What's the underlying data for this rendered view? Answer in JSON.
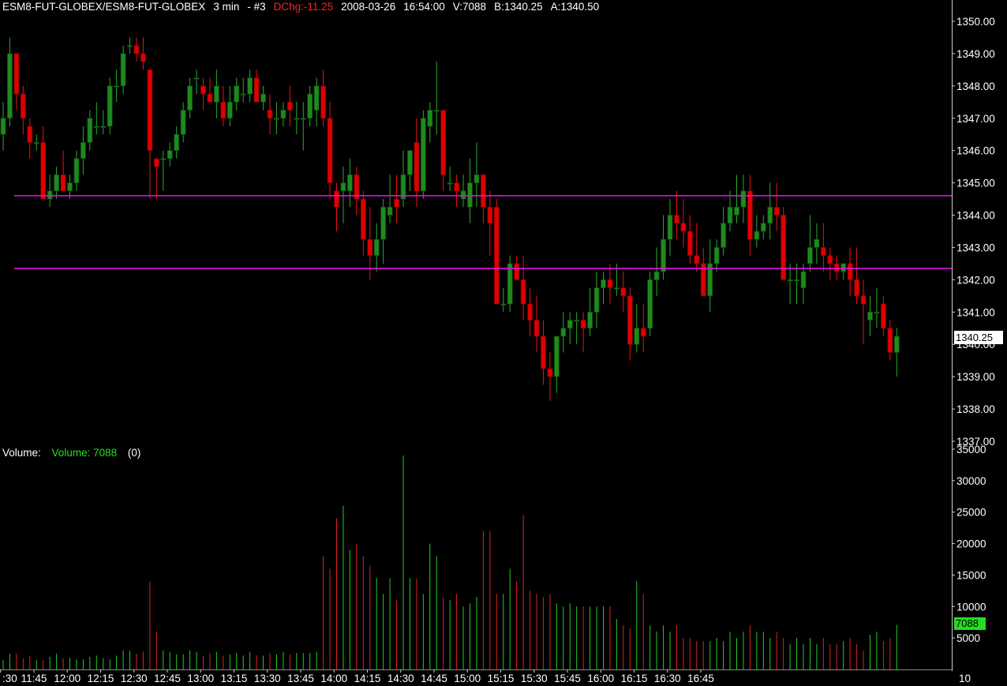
{
  "header": {
    "symbol": "ESM8-FUT-GLOBEX/ESM8-FUT-GLOBEX",
    "interval": "3 min",
    "tag": "- #3",
    "dchg": "DChg:-11.25",
    "date": "2008-03-26",
    "time": "16:54:00",
    "volume": "V:7088",
    "bid": "B:1340.25",
    "ask": "A:1340.50"
  },
  "volume_label": {
    "title": "Volume:",
    "value": "Volume: 7088",
    "param": "(0)"
  },
  "colors": {
    "up": "#1f8a1f",
    "down": "#e00000",
    "line": "#e010e0",
    "up_volume": "#22cc22",
    "down_volume": "#dd2222",
    "axis_text": "#ffffff",
    "last_volume_bg": "#22dd22"
  },
  "current_price_label": "1340.25",
  "current_volume_label": "7088",
  "chart_data": [
    {
      "type": "candlestick",
      "title": "ESM8-FUT-GLOBEX 3 min",
      "ylim": [
        1337,
        1350.25
      ],
      "yticks": [
        "1337.00",
        "1338.00",
        "1339.00",
        "1340.00",
        "1341.00",
        "1342.00",
        "1343.00",
        "1344.00",
        "1345.00",
        "1346.00",
        "1347.00",
        "1348.00",
        "1349.00",
        "1350.00"
      ],
      "xticks": [
        ":30",
        "11:45",
        "12:00",
        "12:15",
        "12:30",
        "12:45",
        "13:00",
        "13:15",
        "13:30",
        "13:45",
        "14:00",
        "14:15",
        "14:30",
        "14:45",
        "15:00",
        "15:15",
        "15:30",
        "15:45",
        "16:00",
        "16:15",
        "16:30",
        "16:45"
      ],
      "horizontal_lines": [
        1344.6,
        1342.35
      ],
      "candles": [
        [
          1346.5,
          1347.5,
          1346,
          1347
        ],
        [
          1347,
          1349.5,
          1346.75,
          1349
        ],
        [
          1349,
          1349,
          1347.25,
          1347.75
        ],
        [
          1347.75,
          1348,
          1346.5,
          1347
        ],
        [
          1346.75,
          1347,
          1345.75,
          1346.25
        ],
        [
          1346.25,
          1346.5,
          1346,
          1346.25
        ],
        [
          1346.25,
          1346.75,
          1344.5,
          1344.5
        ],
        [
          1344.5,
          1345.25,
          1344.25,
          1344.75
        ],
        [
          1344.75,
          1345.5,
          1344.5,
          1345.25
        ],
        [
          1345.25,
          1346,
          1344.75,
          1344.75
        ],
        [
          1344.75,
          1345.25,
          1344.5,
          1345
        ],
        [
          1345,
          1346,
          1344.75,
          1345.75
        ],
        [
          1345.75,
          1346.75,
          1345.25,
          1346.25
        ],
        [
          1346.25,
          1347.25,
          1346,
          1347
        ],
        [
          1346.75,
          1347.5,
          1346.5,
          1346.75
        ],
        [
          1346.75,
          1347.25,
          1346.5,
          1346.75
        ],
        [
          1346.75,
          1348.25,
          1346.5,
          1348
        ],
        [
          1348,
          1348.5,
          1347.5,
          1348
        ],
        [
          1348,
          1349.25,
          1347.75,
          1349
        ],
        [
          1349.25,
          1349.5,
          1349,
          1349.25
        ],
        [
          1349.25,
          1349.5,
          1348.75,
          1349
        ],
        [
          1349,
          1349.5,
          1348.5,
          1348.75
        ],
        [
          1348.5,
          1348.5,
          1344.5,
          1346
        ],
        [
          1345.75,
          1345.75,
          1344.5,
          1345.5
        ],
        [
          1345.75,
          1346,
          1344.75,
          1345.75
        ],
        [
          1345.75,
          1346.25,
          1345.5,
          1346
        ],
        [
          1346,
          1346.75,
          1345.75,
          1346.5
        ],
        [
          1346.5,
          1347.5,
          1346.25,
          1347.25
        ],
        [
          1347.25,
          1348.25,
          1347,
          1348
        ],
        [
          1348.25,
          1348.5,
          1347.75,
          1348.25
        ],
        [
          1348,
          1348.25,
          1347.25,
          1347.75
        ],
        [
          1347.75,
          1348.25,
          1347.5,
          1347.5
        ],
        [
          1347.5,
          1348.5,
          1347,
          1348
        ],
        [
          1347.5,
          1348,
          1346.75,
          1347
        ],
        [
          1347,
          1348,
          1346.75,
          1347.5
        ],
        [
          1347.5,
          1348.25,
          1347.25,
          1348
        ],
        [
          1347.75,
          1348.25,
          1347.5,
          1347.75
        ],
        [
          1347.75,
          1348.5,
          1347.5,
          1348.25
        ],
        [
          1348.25,
          1348.5,
          1347.5,
          1347.5
        ],
        [
          1347.5,
          1348,
          1347.25,
          1347.75
        ],
        [
          1347.25,
          1347.75,
          1346.5,
          1347
        ],
        [
          1347,
          1347.5,
          1346.5,
          1347
        ],
        [
          1347,
          1347.5,
          1346.75,
          1347.25
        ],
        [
          1347.5,
          1348,
          1346.75,
          1347.25
        ],
        [
          1347,
          1347.5,
          1346.5,
          1347
        ],
        [
          1347,
          1347.5,
          1346,
          1347
        ],
        [
          1347,
          1348,
          1346.75,
          1347.75
        ],
        [
          1347.25,
          1348.25,
          1346.75,
          1348
        ],
        [
          1348,
          1348.5,
          1346.75,
          1347
        ],
        [
          1347,
          1347.5,
          1344.5,
          1345
        ],
        [
          1344.75,
          1345,
          1343.5,
          1344.25
        ],
        [
          1344.75,
          1345.5,
          1343.75,
          1345
        ],
        [
          1344.75,
          1345.75,
          1344.25,
          1345.25
        ],
        [
          1345.25,
          1345.5,
          1344,
          1344.5
        ],
        [
          1344.5,
          1344.75,
          1342.75,
          1343.25
        ],
        [
          1343.25,
          1344.25,
          1342,
          1342.75
        ],
        [
          1342.75,
          1343.75,
          1342.25,
          1343.25
        ],
        [
          1343.25,
          1344.5,
          1342.5,
          1344.25
        ],
        [
          1344,
          1345.25,
          1343.75,
          1344.25
        ],
        [
          1344.5,
          1345.25,
          1343.75,
          1344.25
        ],
        [
          1344.5,
          1346,
          1344.25,
          1345.25
        ],
        [
          1345.25,
          1346,
          1344.75,
          1346
        ],
        [
          1346.25,
          1347,
          1344.25,
          1344.75
        ],
        [
          1344.75,
          1347.25,
          1344.5,
          1347
        ],
        [
          1346.75,
          1347.5,
          1346.25,
          1347.25
        ],
        [
          1347.25,
          1348.75,
          1346.5,
          1347.25
        ],
        [
          1347.25,
          1347.25,
          1344.75,
          1345.25
        ],
        [
          1345,
          1345.5,
          1344.75,
          1345
        ],
        [
          1345,
          1345.25,
          1344.25,
          1344.75
        ],
        [
          1344.5,
          1345.25,
          1344.25,
          1344.75
        ],
        [
          1344.25,
          1345.75,
          1343.75,
          1345
        ],
        [
          1345,
          1346.25,
          1344.25,
          1345.25
        ],
        [
          1345.25,
          1345.25,
          1343.75,
          1344.25
        ],
        [
          1344.25,
          1344.75,
          1342.75,
          1343.75
        ],
        [
          1344.25,
          1344.5,
          1341.25,
          1341.25
        ],
        [
          1341.25,
          1341.75,
          1341,
          1341.25
        ],
        [
          1341.25,
          1342.75,
          1341,
          1342.5
        ],
        [
          1342.5,
          1342.75,
          1342,
          1342
        ],
        [
          1342,
          1342.75,
          1340.75,
          1341.25
        ],
        [
          1341.25,
          1341.75,
          1340.25,
          1340.75
        ],
        [
          1340.75,
          1341.5,
          1339.75,
          1340.25
        ],
        [
          1340.25,
          1340.75,
          1338.75,
          1339.25
        ],
        [
          1339.25,
          1339.75,
          1338.25,
          1339
        ],
        [
          1339,
          1340,
          1338.5,
          1340.25
        ],
        [
          1340.25,
          1341,
          1339.75,
          1340.5
        ],
        [
          1340.5,
          1341,
          1340,
          1340.75
        ],
        [
          1340.75,
          1341,
          1340,
          1340.75
        ],
        [
          1340.75,
          1341,
          1339.75,
          1340.5
        ],
        [
          1340.5,
          1341.75,
          1340.25,
          1341
        ],
        [
          1341,
          1342.25,
          1340.5,
          1341.75
        ],
        [
          1341.75,
          1342.25,
          1341.25,
          1342
        ],
        [
          1342,
          1342.5,
          1341.25,
          1341.75
        ],
        [
          1341.75,
          1342.5,
          1341.5,
          1341.75
        ],
        [
          1341.75,
          1342.25,
          1341,
          1341.5
        ],
        [
          1341.5,
          1341.75,
          1339.5,
          1340
        ],
        [
          1340,
          1341.25,
          1339.75,
          1340.5
        ],
        [
          1340.5,
          1341.25,
          1339.75,
          1340.25
        ],
        [
          1340.5,
          1342.25,
          1340.25,
          1342
        ],
        [
          1342,
          1343,
          1341.5,
          1342.25
        ],
        [
          1342.25,
          1344,
          1342,
          1343.25
        ],
        [
          1343.25,
          1344.5,
          1342.75,
          1344
        ],
        [
          1344,
          1344.75,
          1343.25,
          1343.75
        ],
        [
          1343.75,
          1344.5,
          1343,
          1343.5
        ],
        [
          1343.5,
          1344,
          1342.5,
          1342.75
        ],
        [
          1342.75,
          1343.75,
          1342.25,
          1342.5
        ],
        [
          1342.5,
          1343,
          1341.75,
          1341.5
        ],
        [
          1341.5,
          1343.25,
          1341,
          1342.5
        ],
        [
          1342.5,
          1343.25,
          1342.25,
          1343
        ],
        [
          1343,
          1344.25,
          1342.75,
          1343.75
        ],
        [
          1343.75,
          1344.75,
          1343.5,
          1344.25
        ],
        [
          1344,
          1345.25,
          1343.75,
          1344.25
        ],
        [
          1344.25,
          1345.25,
          1343.75,
          1344.75
        ],
        [
          1344.75,
          1345.25,
          1342.75,
          1343.25
        ],
        [
          1343.25,
          1344,
          1343,
          1343.5
        ],
        [
          1343.5,
          1344,
          1343.25,
          1343.75
        ],
        [
          1343.75,
          1345,
          1343.25,
          1344.25
        ],
        [
          1344.25,
          1345,
          1343.5,
          1344
        ],
        [
          1344,
          1344.25,
          1342,
          1342
        ],
        [
          1342,
          1342.5,
          1341.25,
          1342
        ],
        [
          1342,
          1342.5,
          1341.25,
          1342
        ],
        [
          1341.75,
          1342.5,
          1341.25,
          1342.25
        ],
        [
          1342.5,
          1344,
          1342.25,
          1343
        ],
        [
          1343,
          1343.75,
          1342.5,
          1343.25
        ],
        [
          1343,
          1343.75,
          1342.25,
          1342.75
        ],
        [
          1342.75,
          1343,
          1342,
          1342.5
        ],
        [
          1342.5,
          1342.75,
          1342,
          1342.25
        ],
        [
          1342.25,
          1342.5,
          1342,
          1342.5
        ],
        [
          1342.5,
          1343,
          1341.5,
          1342
        ],
        [
          1342,
          1343,
          1341.25,
          1341.5
        ],
        [
          1341.5,
          1342,
          1340,
          1341.25
        ],
        [
          1340.75,
          1341.5,
          1340.25,
          1341
        ],
        [
          1341,
          1341.75,
          1340.5,
          1341
        ],
        [
          1341.25,
          1341.5,
          1340.25,
          1340.5
        ],
        [
          1340.5,
          1340.75,
          1339.5,
          1339.75
        ],
        [
          1339.75,
          1340.5,
          1339,
          1340.25
        ]
      ]
    },
    {
      "type": "bar",
      "title": "Volume",
      "ylim": [
        0,
        37500
      ],
      "yticks": [
        "5000",
        "10000",
        "15000",
        "20000",
        "25000",
        "30000",
        "35000"
      ],
      "baseline_label": "10",
      "values": [
        1500,
        2500,
        2500,
        1800,
        2200,
        1500,
        1500,
        2000,
        2500,
        1800,
        1800,
        1600,
        1600,
        2000,
        2200,
        1800,
        1600,
        2200,
        3000,
        3000,
        2500,
        2800,
        14000,
        6000,
        3000,
        2800,
        2400,
        2400,
        3000,
        2800,
        2200,
        2600,
        2800,
        2200,
        2400,
        2600,
        2200,
        2800,
        2200,
        2200,
        2600,
        2400,
        2800,
        2400,
        2600,
        2600,
        2600,
        2800,
        18000,
        16000,
        24000,
        26000,
        19000,
        20000,
        18000,
        16500,
        14500,
        12000,
        14500,
        11000,
        34000,
        14500,
        14500,
        12000,
        20000,
        18000,
        11500,
        11000,
        12000,
        10000,
        10500,
        11500,
        22000,
        22000,
        12000,
        12000,
        16000,
        14000,
        24500,
        12500,
        12000,
        11500,
        12000,
        10500,
        10000,
        10500,
        10000,
        10000,
        10000,
        10000,
        10000,
        10000,
        8000,
        7000,
        6500,
        14000,
        12000,
        7000,
        6000,
        7000,
        6000,
        7000,
        5000,
        5000,
        4500,
        4500,
        4500,
        5000,
        4500,
        6000,
        5000,
        6000,
        7000,
        6000,
        6000,
        5000,
        6000,
        5000,
        4000,
        5000,
        4000,
        5000,
        4000,
        5000,
        4000,
        4000,
        4500,
        5000,
        4000,
        3000,
        5500,
        6000,
        4500,
        5000,
        7088
      ]
    }
  ]
}
